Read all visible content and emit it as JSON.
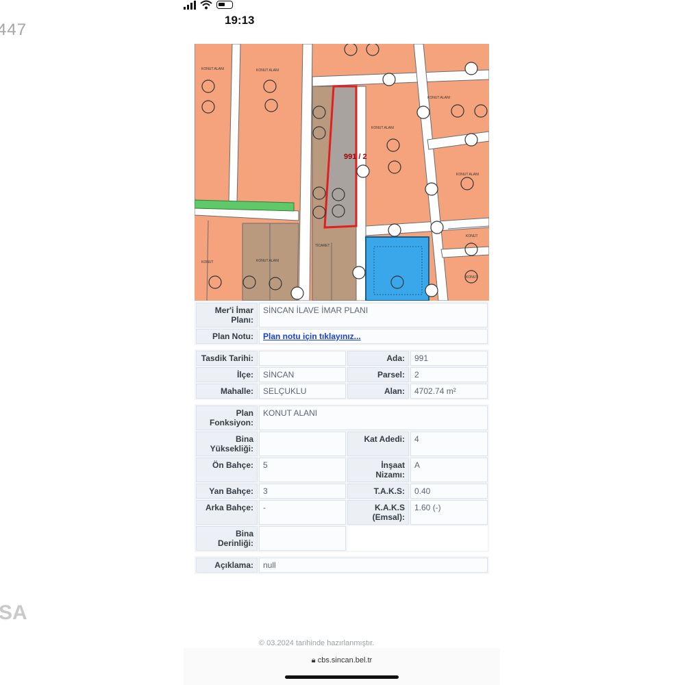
{
  "side": {
    "left_number": "447",
    "left_logo": "SA"
  },
  "status_bar": {
    "time": "19:13"
  },
  "map": {
    "parcel_label": "991 / 2"
  },
  "info": {
    "meri_imar_plani": {
      "label": "Mer'i İmar Planı:",
      "value": "SİNCAN İLAVE İMAR PLANI"
    },
    "plan_notu": {
      "label": "Plan Notu:",
      "link": "Plan notu için tıklayınız..."
    },
    "tasdik_tarihi": {
      "label": "Tasdik Tarihi:",
      "value": ""
    },
    "ada": {
      "label": "Ada:",
      "value": "991"
    },
    "ilce": {
      "label": "İlçe:",
      "value": "SİNCAN"
    },
    "parsel": {
      "label": "Parsel:",
      "value": "2"
    },
    "mahalle": {
      "label": "Mahalle:",
      "value": "SELÇUKLU"
    },
    "alan": {
      "label": "Alan:",
      "value": "4702.74 m²"
    },
    "plan_fonksiyon": {
      "label": "Plan Fonksiyon:",
      "value": "KONUT ALANI"
    },
    "bina_yuksekligi": {
      "label": "Bina Yüksekliği:",
      "value": ""
    },
    "kat_adedi": {
      "label": "Kat Adedi:",
      "value": "4"
    },
    "on_bahce": {
      "label": "Ön Bahçe:",
      "value": "5"
    },
    "insaat_nizami": {
      "label": "İnşaat Nizamı:",
      "value": "A"
    },
    "yan_bahce": {
      "label": "Yan Bahçe:",
      "value": "3"
    },
    "taks": {
      "label": "T.A.K.S:",
      "value": "0.40"
    },
    "arka_bahce": {
      "label": "Arka Bahçe:",
      "value": "-"
    },
    "kaks": {
      "label": "K.A.K.S (Emsal):",
      "value": "1.60 (-)"
    },
    "bina_derinligi": {
      "label": "Bina Derinliği:",
      "value": ""
    },
    "aciklama": {
      "label": "Açıklama:",
      "value": "null"
    }
  },
  "footer": {
    "note": "© 03.2024 tarihinde hazırlanmıştır.",
    "url": "cbs.sincan.bel.tr"
  },
  "colors": {
    "residential": "#f4a37d",
    "commercial": "#b99a7f",
    "selected_parcel": "#a9a3a0",
    "parcel_border": "#e02020",
    "park": "#5fc96a",
    "school": "#3aa7ea"
  }
}
